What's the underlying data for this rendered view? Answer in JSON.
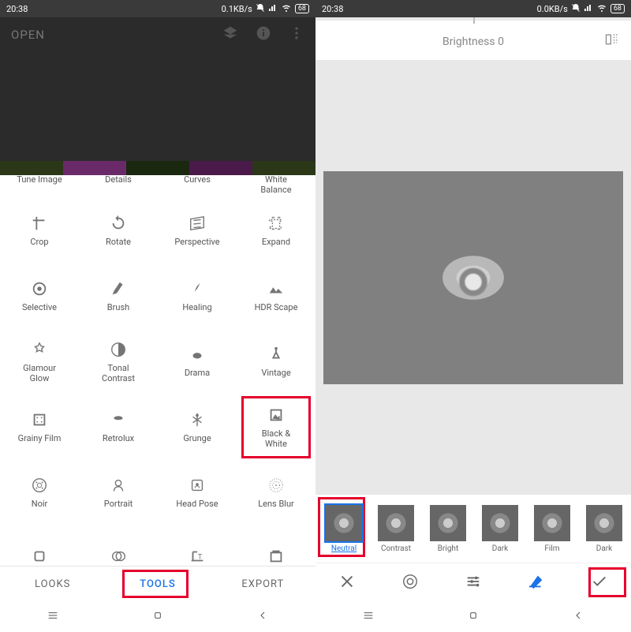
{
  "left": {
    "status": {
      "time": "20:38",
      "net": "0.1KB/s",
      "batt": "68"
    },
    "open": "OPEN",
    "label_row": [
      "Tune Image",
      "Details",
      "Curves",
      "White\nBalance"
    ],
    "tools": [
      "Crop",
      "Rotate",
      "Perspective",
      "Expand",
      "Selective",
      "Brush",
      "Healing",
      "HDR Scape",
      "Glamour\nGlow",
      "Tonal\nContrast",
      "Drama",
      "Vintage",
      "Grainy Film",
      "Retrolux",
      "Grunge",
      "Black &\nWhite",
      "Noir",
      "Portrait",
      "Head Pose",
      "Lens Blur",
      "",
      "",
      "",
      ""
    ],
    "tabs": {
      "looks": "LOOKS",
      "tools": "TOOLS",
      "export": "EXPORT"
    }
  },
  "right": {
    "status": {
      "time": "20:38",
      "net": "0.0KB/s",
      "batt": "68"
    },
    "brightness": "Brightness 0",
    "filters": [
      "Neutral",
      "Contrast",
      "Bright",
      "Dark",
      "Film",
      "Dark"
    ]
  }
}
